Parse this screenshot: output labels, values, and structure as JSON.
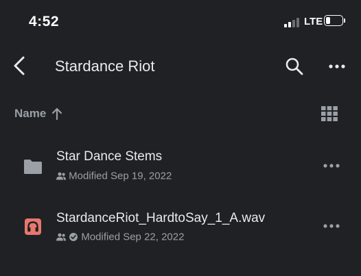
{
  "status_bar": {
    "time": "4:52",
    "network": "LTE",
    "signal_bars": 2,
    "signal_bars_total": 4,
    "battery_level": 0.3
  },
  "app_bar": {
    "title": "Stardance Riot",
    "back_icon": "chevron-left-icon",
    "search_icon": "search-icon",
    "more_icon": "more-horizontal-icon"
  },
  "sort": {
    "label": "Name",
    "direction_icon": "arrow-up-icon",
    "view_icon": "grid-view-icon"
  },
  "items": [
    {
      "name": "Star Dance Stems",
      "modified": "Modified Sep 19, 2022",
      "type": "folder",
      "icon": "folder-icon",
      "shared": true,
      "offline_available": false
    },
    {
      "name": "StardanceRiot_HardtoSay_1_A.wav",
      "modified": "Modified Sep 22, 2022",
      "type": "audio",
      "icon": "audio-file-icon",
      "shared": true,
      "offline_available": true
    }
  ],
  "colors": {
    "background": "#202124",
    "text_primary": "#e8eaed",
    "text_secondary": "#9aa0a6",
    "folder": "#9aa0a6",
    "audio_icon_bg": "#e8776d",
    "audio_icon_fg": "#202124"
  }
}
